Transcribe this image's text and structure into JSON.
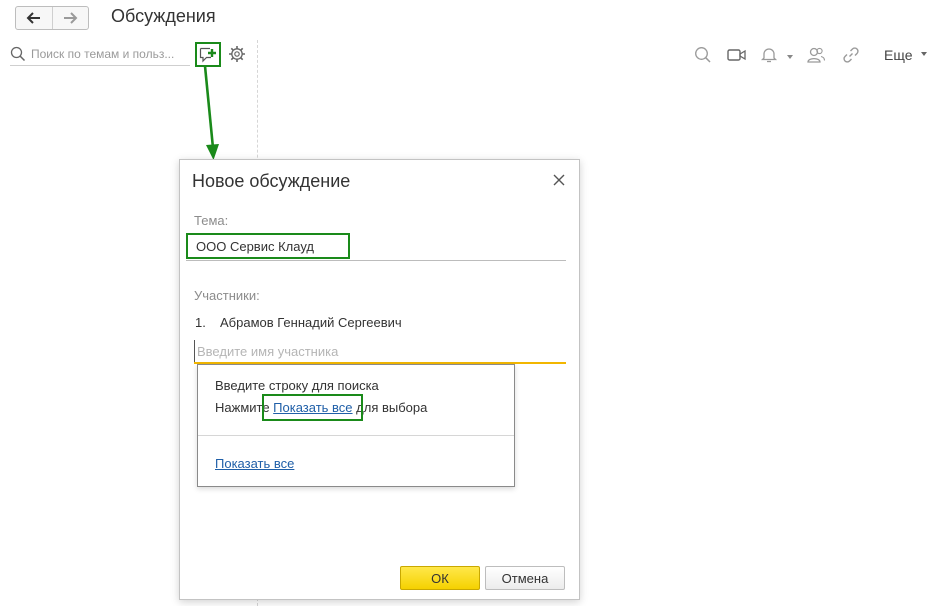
{
  "header": {
    "title": "Обсуждения"
  },
  "search": {
    "placeholder": "Поиск по темам и польз..."
  },
  "toolbar": {
    "more_label": "Еще"
  },
  "dialog": {
    "title": "Новое обсуждение",
    "topic_label": "Тема:",
    "topic_value": "ООО Сервис Клауд",
    "participants_label": "Участники:",
    "participants": [
      {
        "number": "1.",
        "name": "Абрамов Геннадий Сергеевич"
      }
    ],
    "participant_placeholder": "Введите имя участника",
    "popup": {
      "line1": "Введите строку для поиска",
      "line2_before": "Нажмите ",
      "line2_link": "Показать все",
      "line2_after": " для выбора",
      "show_all": "Показать все"
    },
    "ok_label": "ОК",
    "cancel_label": "Отмена"
  },
  "colors": {
    "highlight_green": "#1a8a1a",
    "accent_yellow": "#f5d100",
    "link_blue": "#1f5fa8"
  },
  "icons": [
    "back-arrow-icon",
    "forward-arrow-icon",
    "search-icon",
    "new-discussion-icon",
    "gear-icon",
    "video-icon",
    "bell-icon",
    "users-icon",
    "link-icon",
    "close-icon",
    "annotation-arrow"
  ]
}
